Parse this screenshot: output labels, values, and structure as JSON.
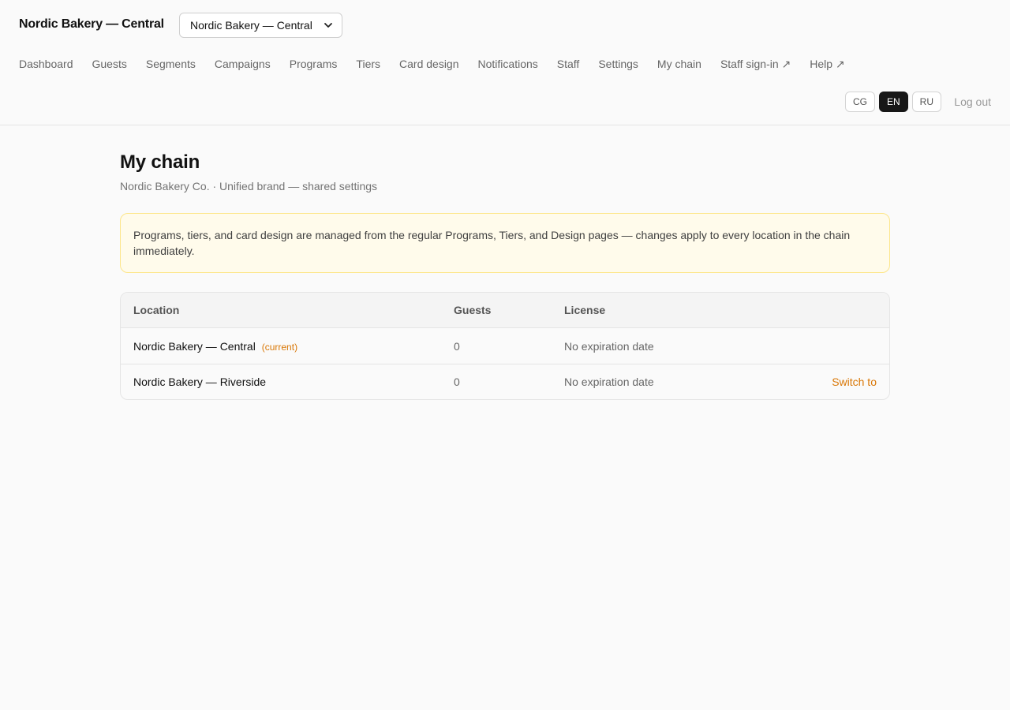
{
  "header": {
    "brand": "Nordic Bakery — Central",
    "location_select": {
      "value": "Nordic Bakery — Central"
    },
    "nav": [
      {
        "label": "Dashboard"
      },
      {
        "label": "Guests"
      },
      {
        "label": "Segments"
      },
      {
        "label": "Campaigns"
      },
      {
        "label": "Programs"
      },
      {
        "label": "Tiers"
      },
      {
        "label": "Card design"
      },
      {
        "label": "Notifications"
      },
      {
        "label": "Staff"
      },
      {
        "label": "Settings"
      },
      {
        "label": "My chain"
      },
      {
        "label": "Staff sign-in ↗"
      },
      {
        "label": "Help ↗"
      }
    ],
    "languages": [
      {
        "code": "CG",
        "active": false
      },
      {
        "code": "EN",
        "active": true
      },
      {
        "code": "RU",
        "active": false
      }
    ],
    "logout_label": "Log out"
  },
  "page": {
    "title": "My chain",
    "subtitle": "Nordic Bakery Co. · Unified brand — shared settings",
    "notice": "Programs, tiers, and card design are managed from the regular Programs, Tiers, and Design pages — changes apply to every location in the chain immediately."
  },
  "table": {
    "columns": [
      "Location",
      "Guests",
      "License"
    ],
    "rows": [
      {
        "location": "Nordic Bakery — Central",
        "tag": "(current)",
        "guests": "0",
        "license": "No expiration date",
        "action": ""
      },
      {
        "location": "Nordic Bakery — Riverside",
        "tag": "",
        "guests": "0",
        "license": "No expiration date",
        "action": "Switch to"
      }
    ]
  },
  "colors": {
    "accent": "#d97706",
    "notice_bg": "#fffbeb",
    "notice_border": "#fde68a",
    "active_lang_bg": "#171717"
  }
}
